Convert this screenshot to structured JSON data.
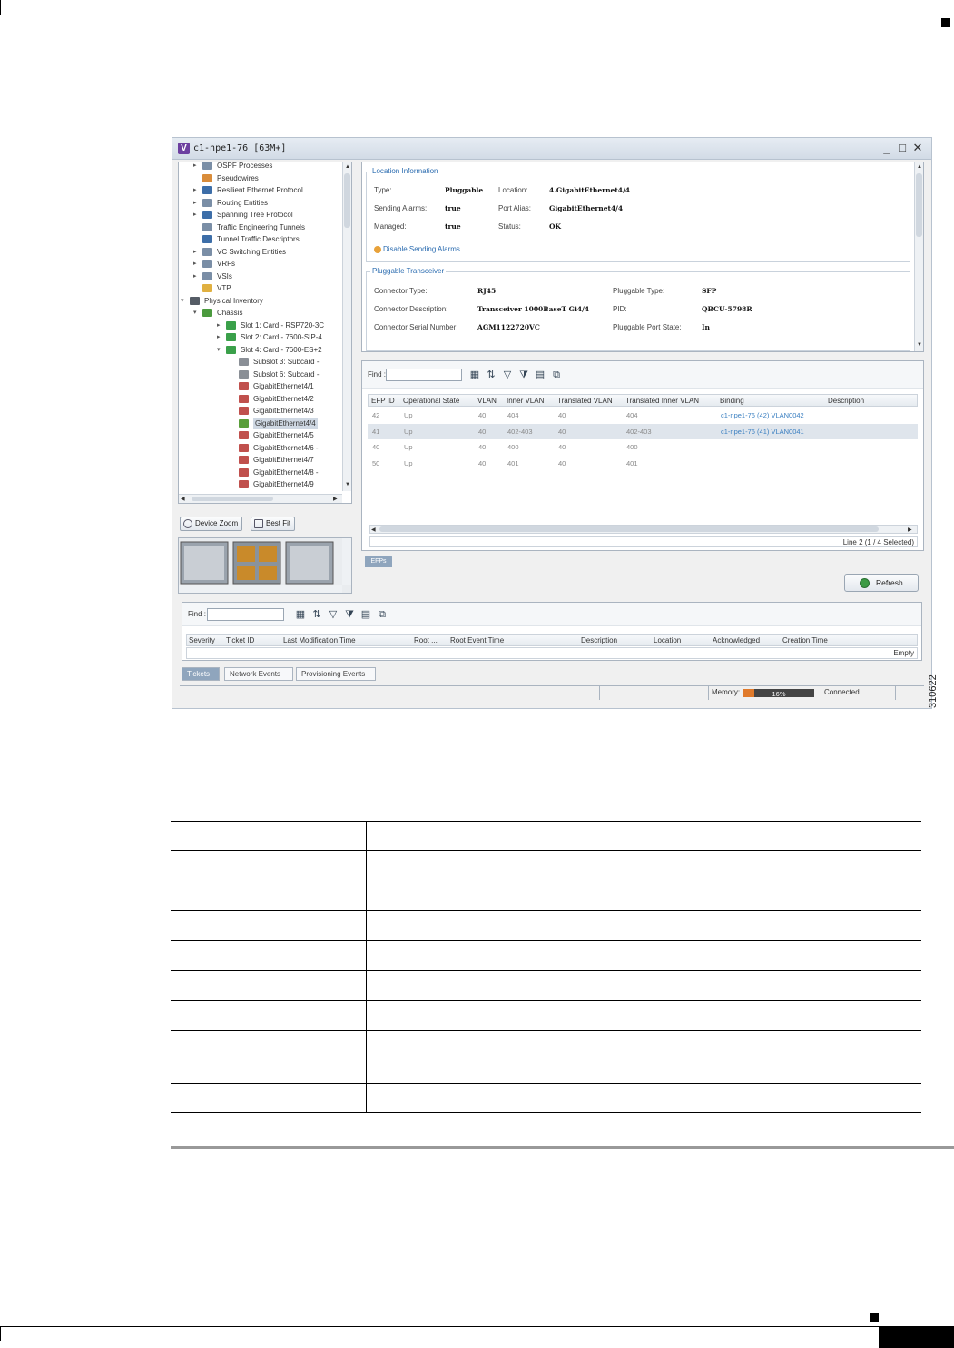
{
  "window": {
    "title": "c1-npe1-76 [63M+]",
    "logo": "V",
    "min": "_",
    "max": "□",
    "close": "✕"
  },
  "tree": {
    "items": [
      {
        "label": "OSPF Processes",
        "indent": 2,
        "color": "#7a8ea6",
        "exp": "▸"
      },
      {
        "label": "Pseudowires",
        "indent": 2,
        "color": "#d98c3a",
        "exp": ""
      },
      {
        "label": "Resilient Ethernet Protocol",
        "indent": 2,
        "color": "#3d6ea8",
        "exp": "▸"
      },
      {
        "label": "Routing Entities",
        "indent": 2,
        "color": "#7a8ea6",
        "exp": "▸"
      },
      {
        "label": "Spanning Tree Protocol",
        "indent": 2,
        "color": "#3d6ea8",
        "exp": "▸"
      },
      {
        "label": "Traffic Engineering Tunnels",
        "indent": 2,
        "color": "#7a8ea6",
        "exp": ""
      },
      {
        "label": "Tunnel Traffic Descriptors",
        "indent": 2,
        "color": "#3d6ea8",
        "exp": ""
      },
      {
        "label": "VC Switching Entities",
        "indent": 2,
        "color": "#7a8ea6",
        "exp": "▸"
      },
      {
        "label": "VRFs",
        "indent": 2,
        "color": "#7a8ea6",
        "exp": "▸"
      },
      {
        "label": "VSIs",
        "indent": 2,
        "color": "#7a8ea6",
        "exp": "▸"
      },
      {
        "label": "VTP",
        "indent": 2,
        "color": "#e0b040",
        "exp": ""
      },
      {
        "label": "Physical Inventory",
        "indent": 1,
        "color": "#555c66",
        "exp": "▾"
      },
      {
        "label": "Chassis",
        "indent": 2,
        "color": "#4b9a3e",
        "exp": "▾"
      },
      {
        "label": "Slot 1: Card - RSP720-3C",
        "indent": 3,
        "color": "#3aa04a",
        "exp": "▸"
      },
      {
        "label": "Slot 2: Card - 7600-SIP-4",
        "indent": 3,
        "color": "#3aa04a",
        "exp": "▸"
      },
      {
        "label": "Slot 4: Card - 7600-ES+2",
        "indent": 3,
        "color": "#3aa04a",
        "exp": "▾"
      },
      {
        "label": "Subslot 3: Subcard -",
        "indent": 4,
        "color": "#8a8f96",
        "exp": ""
      },
      {
        "label": "Subslot 6: Subcard -",
        "indent": 4,
        "color": "#8a8f96",
        "exp": ""
      },
      {
        "label": "GigabitEthernet4/1",
        "indent": 4,
        "color": "#c0504d",
        "exp": ""
      },
      {
        "label": "GigabitEthernet4/2",
        "indent": 4,
        "color": "#c0504d",
        "exp": ""
      },
      {
        "label": "GigabitEthernet4/3",
        "indent": 4,
        "color": "#c0504d",
        "exp": ""
      },
      {
        "label": "GigabitEthernet4/4",
        "indent": 4,
        "color": "#5a9e3a",
        "exp": "",
        "selected": true
      },
      {
        "label": "GigabitEthernet4/5",
        "indent": 4,
        "color": "#c0504d",
        "exp": ""
      },
      {
        "label": "GigabitEthernet4/6 -",
        "indent": 4,
        "color": "#c0504d",
        "exp": ""
      },
      {
        "label": "GigabitEthernet4/7",
        "indent": 4,
        "color": "#c0504d",
        "exp": ""
      },
      {
        "label": "GigabitEthernet4/8 -",
        "indent": 4,
        "color": "#c0504d",
        "exp": ""
      },
      {
        "label": "GigabitEthernet4/9",
        "indent": 4,
        "color": "#c0504d",
        "exp": ""
      }
    ]
  },
  "zoom": {
    "device_zoom": "Device Zoom",
    "best_fit": "Best Fit"
  },
  "location_info": {
    "title": "Location Information",
    "type_label": "Type:",
    "type_value": "Pluggable",
    "location_label": "Location:",
    "location_value": "4.GigabitEthernet4/4",
    "sending_alarms_label": "Sending Alarms:",
    "sending_alarms_value": "true",
    "port_alias_label": "Port Alias:",
    "port_alias_value": "GigabitEthernet4/4",
    "managed_label": "Managed:",
    "managed_value": "true",
    "status_label": "Status:",
    "status_value": "OK",
    "disable_link": "Disable Sending Alarms"
  },
  "pluggable": {
    "title": "Pluggable Transceiver",
    "connector_type_label": "Connector Type:",
    "connector_type_value": "RJ45",
    "pluggable_type_label": "Pluggable Type:",
    "pluggable_type_value": "SFP",
    "connector_desc_label": "Connector Description:",
    "connector_desc_value": "Transceiver 1000BaseT Gi4/4",
    "pid_label": "PID:",
    "pid_value": "QBCU-5798R",
    "serial_label": "Connector Serial Number:",
    "serial_value": "AGM1122720VC",
    "port_state_label": "Pluggable Port State:",
    "port_state_value": "In"
  },
  "efp": {
    "find_label": "Find :",
    "columns": [
      "EFP ID",
      "Operational State",
      "VLAN",
      "Inner VLAN",
      "Translated VLAN",
      "Translated Inner VLAN",
      "Binding",
      "Description"
    ],
    "rows": [
      [
        "42",
        "Up",
        "40",
        "404",
        "40",
        "404",
        "c1-npe1-76 (42) VLAN0042",
        ""
      ],
      [
        "41",
        "Up",
        "40",
        "402-403",
        "40",
        "402-403",
        "c1-npe1-76 (41) VLAN0041",
        ""
      ],
      [
        "40",
        "Up",
        "40",
        "400",
        "40",
        "400",
        "",
        ""
      ],
      [
        "50",
        "Up",
        "40",
        "401",
        "40",
        "401",
        "",
        ""
      ]
    ],
    "status": "Line 2 (1 / 4 Selected)",
    "tab": "EFPs",
    "refresh": "Refresh"
  },
  "tickets": {
    "find_label": "Find :",
    "columns": [
      "Severity",
      "Ticket ID",
      "Last Modification Time",
      "Root ...",
      "Root Event Time",
      "Description",
      "Location",
      "Acknowledged",
      "Creation Time"
    ],
    "empty": "Empty",
    "tabs": [
      "Tickets",
      "Network Events",
      "Provisioning Events"
    ]
  },
  "statusbar": {
    "memory_label": "Memory:",
    "memory_pct": "16%",
    "memory_fraction": 0.16,
    "connection": "Connected"
  },
  "figure_id": "310622"
}
